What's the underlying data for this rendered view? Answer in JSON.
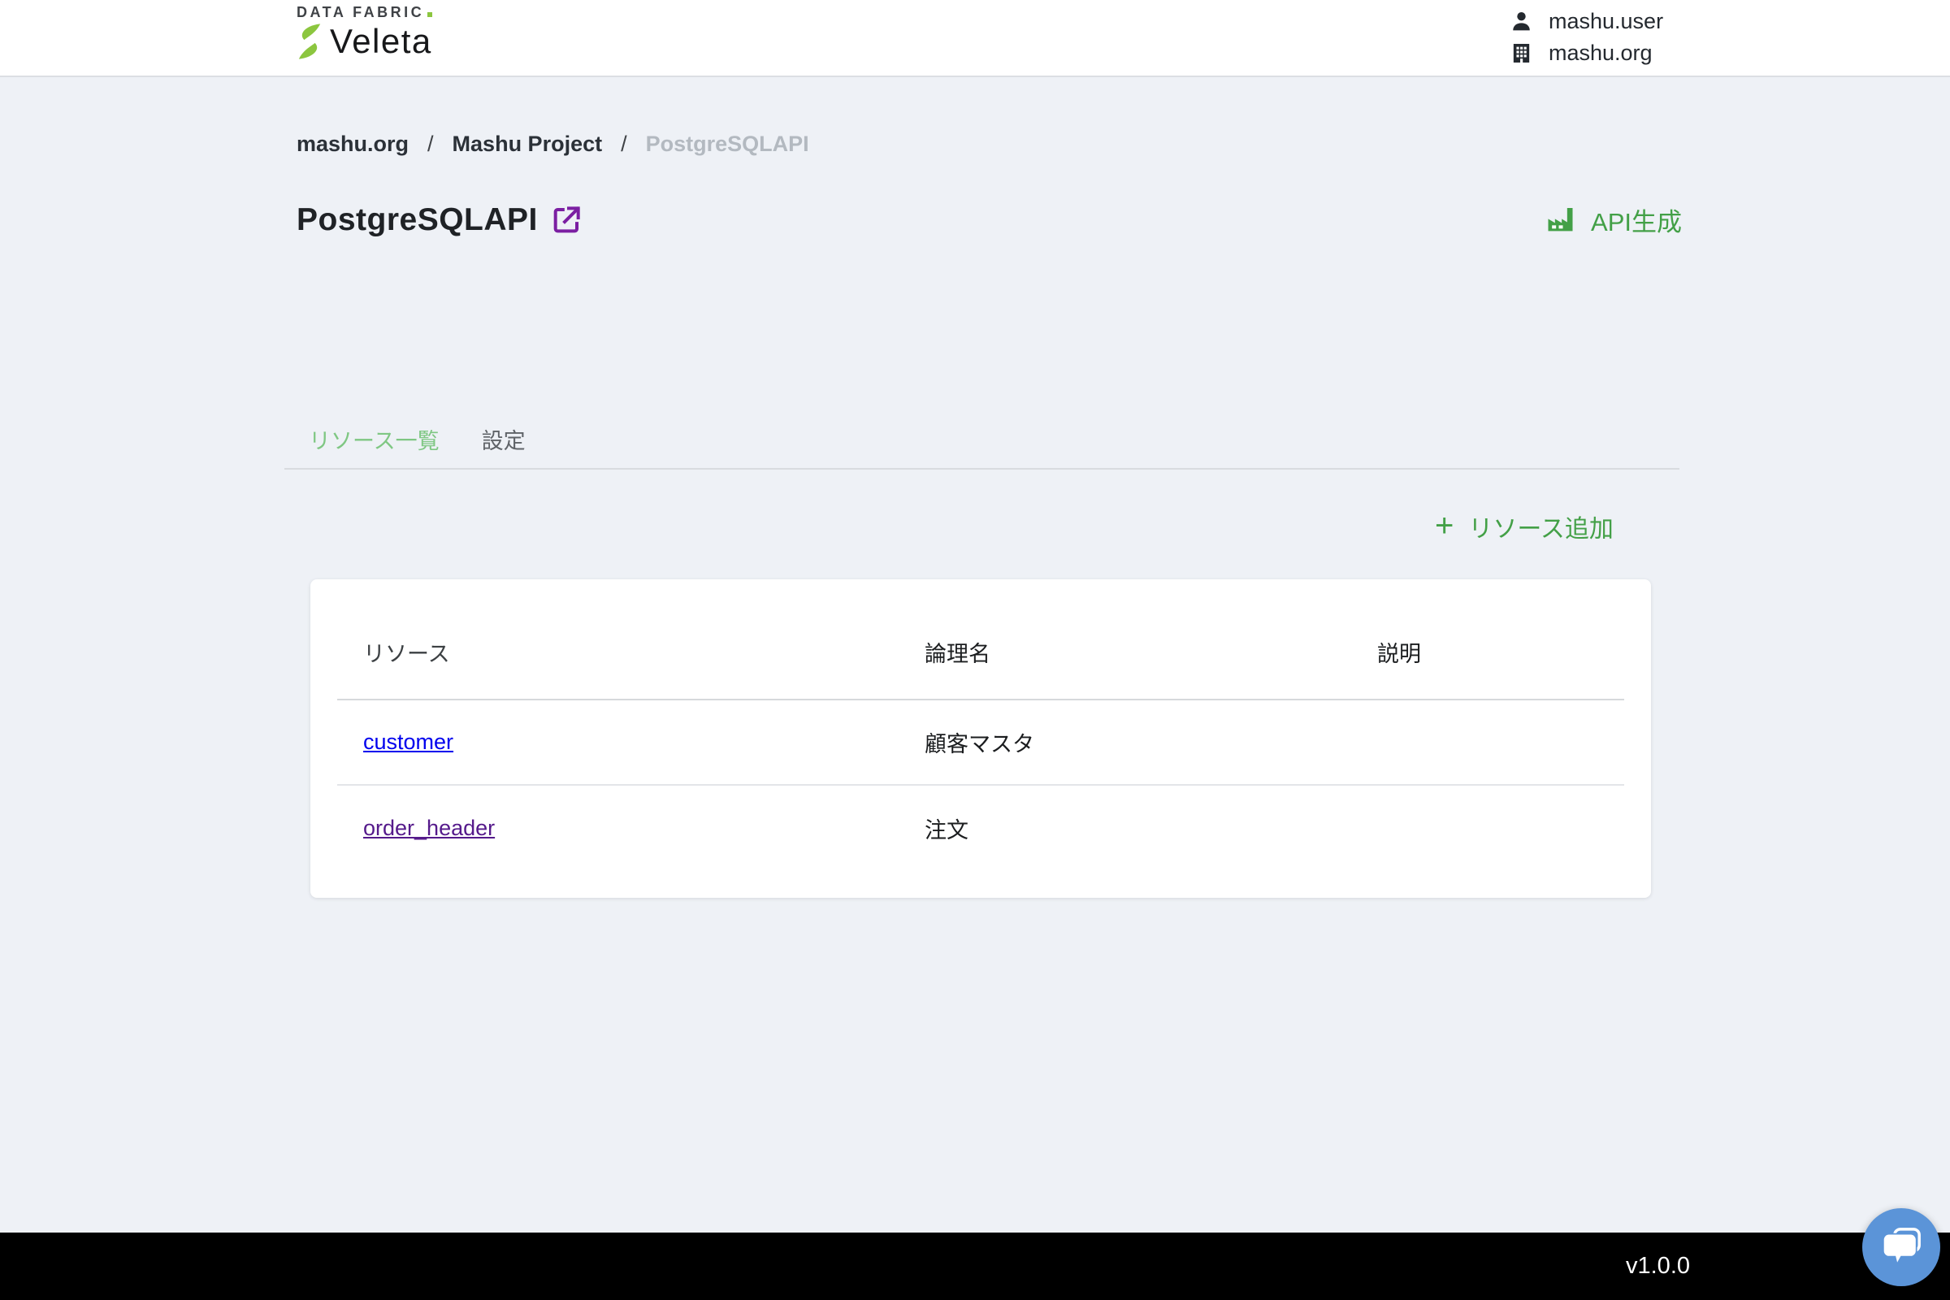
{
  "header": {
    "logo": {
      "top": "DATA FABRIC",
      "name": "Veleta"
    },
    "user": {
      "username": "mashu.user",
      "org": "mashu.org"
    }
  },
  "breadcrumb": {
    "separator": "/",
    "items": [
      {
        "label": "mashu.org"
      },
      {
        "label": "Mashu Project"
      },
      {
        "label": "PostgreSQLAPI"
      }
    ]
  },
  "page": {
    "title": "PostgreSQLAPI",
    "generate_api_label": "API生成"
  },
  "tabs": [
    {
      "label": "リソース一覧",
      "active": true
    },
    {
      "label": "設定",
      "active": false
    }
  ],
  "actions": {
    "plus": "+",
    "add_resource_label": "リソース追加"
  },
  "table": {
    "columns": [
      "リソース",
      "論理名",
      "説明"
    ],
    "rows": [
      {
        "resource": "customer",
        "logical_name": "顧客マスタ",
        "description": ""
      },
      {
        "resource": "order_header",
        "logical_name": "注文",
        "description": ""
      }
    ]
  },
  "footer": {
    "version": "v1.0.0"
  },
  "colors": {
    "page_bg": "#eef1f6",
    "header_bg": "#ffffff",
    "accent_green": "#43a047",
    "tab_active_green": "#7fc783",
    "logo_green": "#8cc63f",
    "purple_icon": "#7b1fa2",
    "link_blue": "#0000ee",
    "link_visited": "#551a8b",
    "chat_blue": "#5b94d8",
    "footer_bg": "#000000"
  }
}
